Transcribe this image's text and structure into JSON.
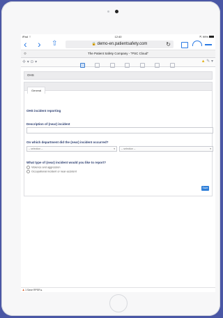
{
  "statusbar": {
    "device": "iPad",
    "wifi": "⌔",
    "time": "12:40",
    "signal": "⇱",
    "battery": "99%"
  },
  "browser": {
    "url": "demo-en.patientsafety.com",
    "lock": "🔒"
  },
  "site": {
    "title": "The Patient Safety Company - \"PSC Cloud\""
  },
  "toolbar": {
    "left_icons": "✢ ▾  ⊙ ▾",
    "right_icon": "▲",
    "right_icon2": "✎ ▾"
  },
  "page": {
    "heading": "OHS"
  },
  "form": {
    "tab_label": "General",
    "title": "OHS incident reporting",
    "question1": "Description of (near) incident",
    "question2": "On which department did the (near) incident occurred?",
    "select1_value": "-- selection --",
    "select2_value": "-- selection --",
    "question3": "What type of (near) incident would you like to report?",
    "options": [
      "Violence and aggression",
      "Occupational incident or near-accident"
    ],
    "save_label": "Save"
  },
  "bottombar": {
    "user": "1 Save RPSR ▸"
  }
}
